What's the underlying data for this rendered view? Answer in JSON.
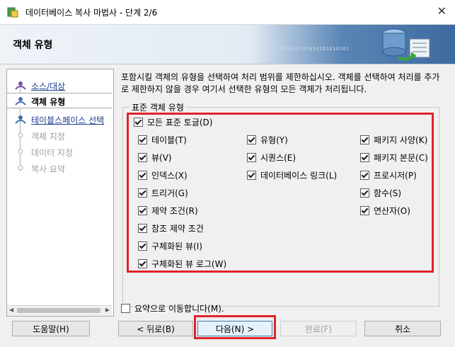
{
  "window": {
    "title": "데이터베이스 복사 마법사 - 단계 2/6"
  },
  "header": {
    "title": "객체 유형",
    "binary": "0101010101010101010101"
  },
  "steps": [
    {
      "label": "소스/대상",
      "state": "link"
    },
    {
      "label": "객체 유형",
      "state": "current"
    },
    {
      "label": "테이블스페이스 선택",
      "state": "link"
    },
    {
      "label": "객체 지정",
      "state": "disabled"
    },
    {
      "label": "데이터 지정",
      "state": "disabled"
    },
    {
      "label": "복사 요약",
      "state": "disabled"
    }
  ],
  "description": "포함시킬 객체의 유형을 선택하여 처리 범위를 제한하십시오. 객체를 선택하여 처리를 추가로 제한하지 않을 경우 여기서 선택한 유형의 모든 객체가 처리됩니다.",
  "group": {
    "legend": "표준 객체 유형",
    "toggle_all": "모든 표준 토글(D)",
    "col1": [
      "테이블(T)",
      "뷰(V)",
      "인덱스(X)",
      "트리거(G)",
      "제약 조건(R)",
      "참조 제약 조건",
      "구체화된 뷰(I)",
      "구체화된 뷰 로그(W)"
    ],
    "col2": [
      "유형(Y)",
      "시퀀스(E)",
      "데이터베이스 링크(L)"
    ],
    "col3": [
      "패키지 사양(K)",
      "패키지 본문(C)",
      "프로시저(P)",
      "함수(S)",
      "연산자(O)"
    ]
  },
  "summary_checkbox": "요약으로 이동합니다(M).",
  "buttons": {
    "help": "도움말(H)",
    "back": "< 뒤로(B)",
    "next": "다음(N) >",
    "finish": "완료(F)",
    "cancel": "취소"
  },
  "colors": {
    "highlight": "#e1232a",
    "link": "#1a3c8e"
  }
}
